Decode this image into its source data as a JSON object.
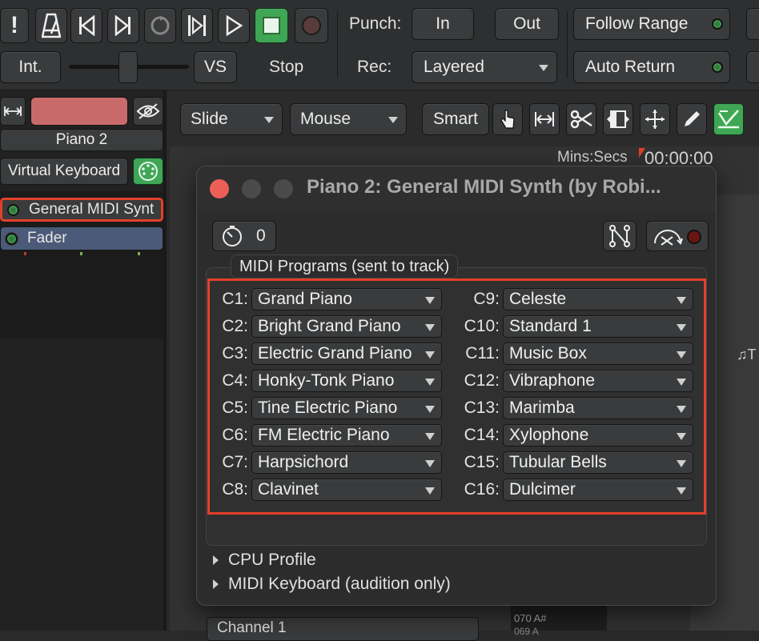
{
  "transport": {
    "int_label": "Int.",
    "vs_label": "VS",
    "stop_label": "Stop",
    "punch_label": "Punch:",
    "punch_in": "In",
    "punch_out": "Out",
    "rec_label": "Rec:",
    "rec_mode": "Layered",
    "follow_range": "Follow Range",
    "auto_return": "Auto Return"
  },
  "edit_toolbar": {
    "edit_mode": "Slide",
    "edit_point": "Mouse",
    "smart": "Smart",
    "clock_label": "Mins:Secs",
    "clock_value": "00:00:00",
    "clock_value_2": ":00"
  },
  "strip": {
    "name": "Piano 2",
    "virtual_keyboard": "Virtual Keyboard",
    "plugins": [
      {
        "label": "General MIDI Synt"
      },
      {
        "label": "Fader"
      }
    ]
  },
  "dialog": {
    "title": "Piano 2: General MIDI Synth (by Robi...",
    "latency_value": "0",
    "group_title": "MIDI Programs (sent to track)",
    "programs_left": [
      {
        "channel": "C1:",
        "program": "Grand Piano"
      },
      {
        "channel": "C2:",
        "program": "Bright Grand Piano"
      },
      {
        "channel": "C3:",
        "program": "Electric Grand Piano"
      },
      {
        "channel": "C4:",
        "program": "Honky-Tonk Piano"
      },
      {
        "channel": "C5:",
        "program": "Tine Electric Piano"
      },
      {
        "channel": "C6:",
        "program": "FM Electric Piano"
      },
      {
        "channel": "C7:",
        "program": "Harpsichord"
      },
      {
        "channel": "C8:",
        "program": "Clavinet"
      }
    ],
    "programs_right": [
      {
        "channel": "C9:",
        "program": "Celeste"
      },
      {
        "channel": "C10:",
        "program": "Standard 1"
      },
      {
        "channel": "C11:",
        "program": "Music Box"
      },
      {
        "channel": "C12:",
        "program": "Vibraphone"
      },
      {
        "channel": "C13:",
        "program": "Marimba"
      },
      {
        "channel": "C14:",
        "program": "Xylophone"
      },
      {
        "channel": "C15:",
        "program": "Tubular Bells"
      },
      {
        "channel": "C16:",
        "program": "Dulcimer"
      }
    ],
    "cpu_profile": "CPU Profile",
    "midi_keyboard": "MIDI Keyboard (audition only)"
  },
  "background": {
    "channel_label": "Channel 1",
    "note_label": "070 A#",
    "note_label_2": "069 A",
    "side_label": "♫T"
  },
  "colors": {
    "highlight": "#e2402a",
    "led_green": "#2f7a3c",
    "fader_blue": "#4b5a78",
    "name_red": "#c96a6a",
    "active_green": "#3fa655"
  }
}
